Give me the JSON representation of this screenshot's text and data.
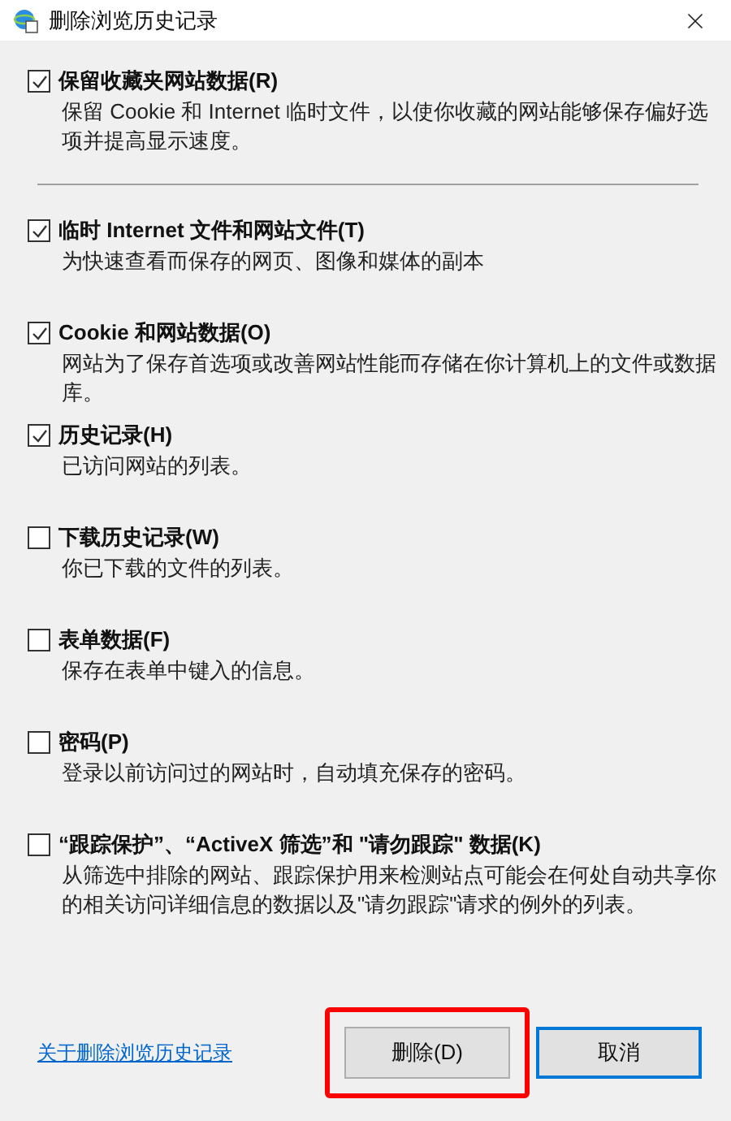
{
  "window": {
    "title": "删除浏览历史记录"
  },
  "options": [
    {
      "label": "保留收藏夹网站数据(R)",
      "description": "保留 Cookie 和 Internet 临时文件，以使你收藏的网站能够保存偏好选项并提高显示速度。",
      "checked": true
    },
    {
      "label": "临时 Internet 文件和网站文件(T)",
      "description": "为快速查看而保存的网页、图像和媒体的副本",
      "checked": true
    },
    {
      "label": "Cookie 和网站数据(O)",
      "description": "网站为了保存首选项或改善网站性能而存储在你计算机上的文件或数据库。",
      "checked": true
    },
    {
      "label": "历史记录(H)",
      "description": "已访问网站的列表。",
      "checked": true
    },
    {
      "label": "下载历史记录(W)",
      "description": "你已下载的文件的列表。",
      "checked": false
    },
    {
      "label": "表单数据(F)",
      "description": "保存在表单中键入的信息。",
      "checked": false
    },
    {
      "label": "密码(P)",
      "description": "登录以前访问过的网站时，自动填充保存的密码。",
      "checked": false
    },
    {
      "label": "“跟踪保护”、“ActiveX 筛选”和 \"请勿跟踪\" 数据(K)",
      "description": "从筛选中排除的网站、跟踪保护用来检测站点可能会在何处自动共享你的相关访问详细信息的数据以及\"请勿跟踪\"请求的例外的列表。",
      "checked": false
    }
  ],
  "link": "关于删除浏览历史记录",
  "buttons": [
    {
      "label": "删除(D)",
      "focused": false,
      "annotated": true
    },
    {
      "label": "取消",
      "focused": true,
      "annotated": false
    }
  ]
}
